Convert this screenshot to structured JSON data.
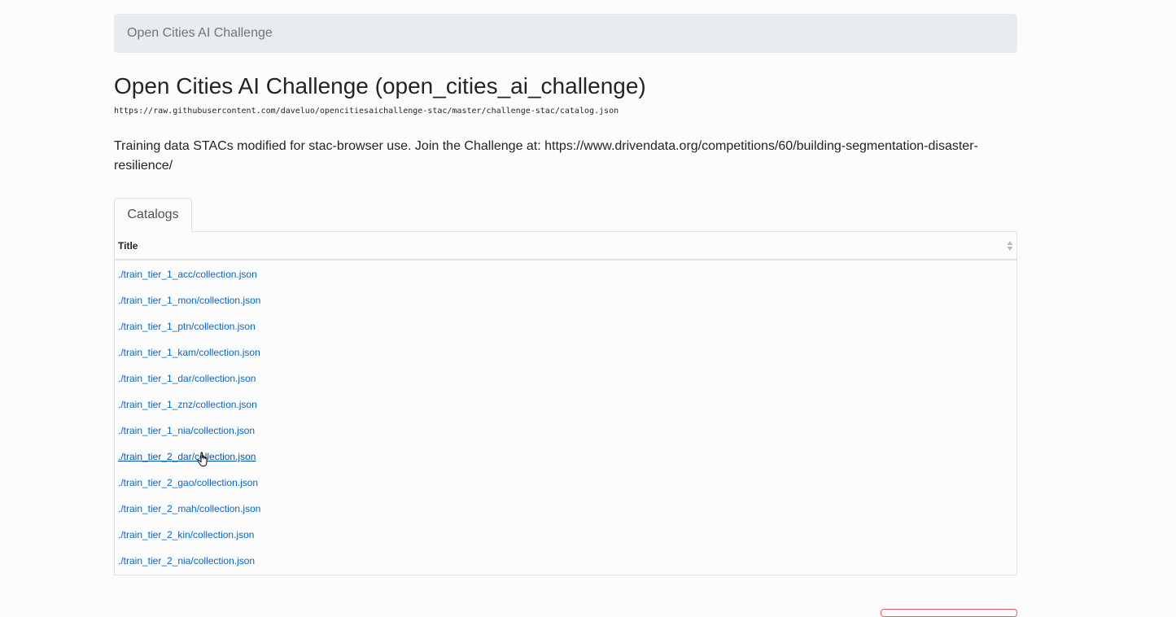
{
  "breadcrumb": {
    "label": "Open Cities AI Challenge"
  },
  "page": {
    "title": "Open Cities AI Challenge (open_cities_ai_challenge)",
    "url": "https://raw.githubusercontent.com/daveluo/opencitiesaichallenge-stac/master/challenge-stac/catalog.json",
    "description": "Training data STACs modified for stac-browser use. Join the Challenge at: https://www.drivendata.org/competitions/60/building-segmentation-disaster-resilience/"
  },
  "tabs": [
    {
      "label": "Catalogs"
    }
  ],
  "table": {
    "header": "Title",
    "rows": [
      "./train_tier_1_acc/collection.json",
      "./train_tier_1_mon/collection.json",
      "./train_tier_1_ptn/collection.json",
      "./train_tier_1_kam/collection.json",
      "./train_tier_1_dar/collection.json",
      "./train_tier_1_znz/collection.json",
      "./train_tier_1_nia/collection.json",
      "./train_tier_2_dar/collection.json",
      "./train_tier_2_gao/collection.json",
      "./train_tier_2_mah/collection.json",
      "./train_tier_2_kin/collection.json",
      "./train_tier_2_nia/collection.json"
    ]
  },
  "colors": {
    "link": "#0366d6",
    "breadcrumb_bg": "#e9ecef",
    "border": "#dee2e6"
  },
  "icons": {
    "sort": "sort-icon",
    "cursor": "hand-pointer-cursor-icon"
  }
}
